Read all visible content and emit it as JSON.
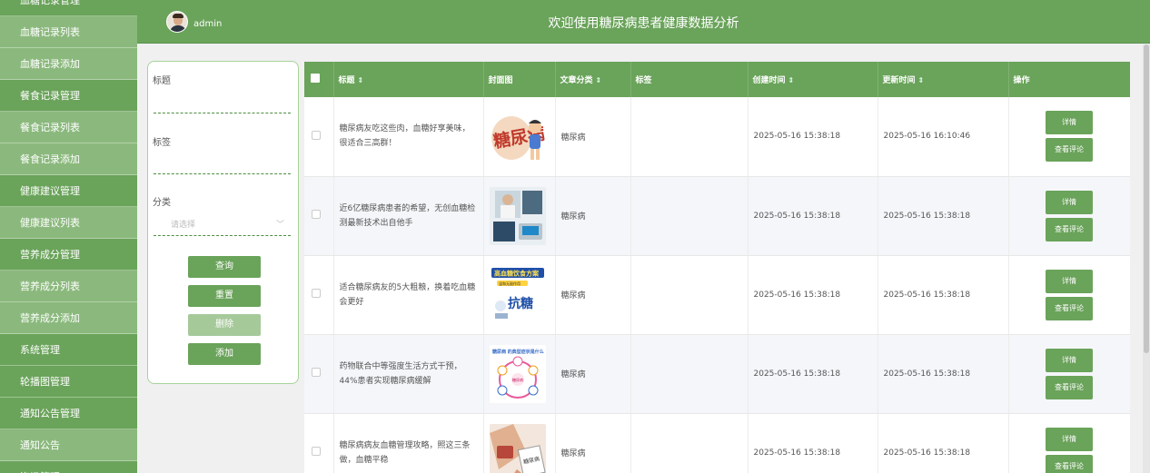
{
  "sidebar": {
    "items": [
      {
        "label": "血糖记录管理",
        "type": "group"
      },
      {
        "label": "血糖记录列表",
        "type": "sub"
      },
      {
        "label": "血糖记录添加",
        "type": "sub"
      },
      {
        "label": "餐食记录管理",
        "type": "group"
      },
      {
        "label": "餐食记录列表",
        "type": "sub"
      },
      {
        "label": "餐食记录添加",
        "type": "sub"
      },
      {
        "label": "健康建议管理",
        "type": "group"
      },
      {
        "label": "健康建议列表",
        "type": "sub"
      },
      {
        "label": "营养成分管理",
        "type": "group"
      },
      {
        "label": "营养成分列表",
        "type": "sub"
      },
      {
        "label": "营养成分添加",
        "type": "sub"
      },
      {
        "label": "系统管理",
        "type": "group"
      },
      {
        "label": "轮播图管理",
        "type": "group"
      },
      {
        "label": "通知公告管理",
        "type": "group"
      },
      {
        "label": "通知公告",
        "type": "sub"
      },
      {
        "label": "资讯管理",
        "type": "group"
      }
    ]
  },
  "header": {
    "username": "admin",
    "title": "欢迎使用糖尿病患者健康数据分析"
  },
  "filter": {
    "title_label": "标题",
    "title_value": "",
    "tag_label": "标签",
    "tag_value": "",
    "category_label": "分类",
    "category_placeholder": "请选择",
    "chevron": "﹀",
    "buttons": {
      "query": "查询",
      "reset": "重置",
      "delete": "删除",
      "add": "添加"
    }
  },
  "table": {
    "sort_glyph": "⇕",
    "columns": {
      "title": "标题",
      "cover": "封面图",
      "category": "文章分类",
      "tags": "标签",
      "created": "创建时间",
      "updated": "更新时间",
      "actions": "操作"
    },
    "detail_label": "详情",
    "comment_label": "查看评论",
    "rows": [
      {
        "title": "糖尿病友吃这些肉，血糖好享美味，很适合三高群！",
        "cover": "cartoon-diabetes",
        "category": "糖尿病",
        "tags": "",
        "created": "2025-05-16 15:38:18",
        "updated": "2025-05-16 16:10:46"
      },
      {
        "title": "近6亿糖尿病患者的希望，无创血糖检测最新技术出自他手",
        "cover": "device-photo",
        "category": "糖尿病",
        "tags": "",
        "created": "2025-05-16 15:38:18",
        "updated": "2025-05-16 15:38:18"
      },
      {
        "title": "适合糖尿病友的5大粗粮，换着吃血糖会更好",
        "cover": "anti-sugar-poster",
        "category": "糖尿病",
        "tags": "",
        "created": "2025-05-16 15:38:18",
        "updated": "2025-05-16 15:38:18"
      },
      {
        "title": "药物联合中等强度生活方式干预，44%患者实现糖尿病缓解",
        "cover": "symptom-diagram",
        "category": "糖尿病",
        "tags": "",
        "created": "2025-05-16 15:38:18",
        "updated": "2025-05-16 15:38:18"
      },
      {
        "title": "糖尿病病友血糖管理攻略，照这三条做，血糖平稳",
        "cover": "hands-photo",
        "category": "糖尿病",
        "tags": "",
        "created": "2025-05-16 15:38:18",
        "updated": "2025-05-16 15:38:18"
      }
    ]
  },
  "thumb_texts": {
    "cartoon": "糖尿病",
    "poster_title": "高血糖饮食方案",
    "poster_sub": "温和无副作用",
    "poster_big": "抗糖",
    "diagram_title": "糖尿病 的典型症状是什么",
    "diagram_center": "糖尿病",
    "hands_card": "糖尿病"
  }
}
